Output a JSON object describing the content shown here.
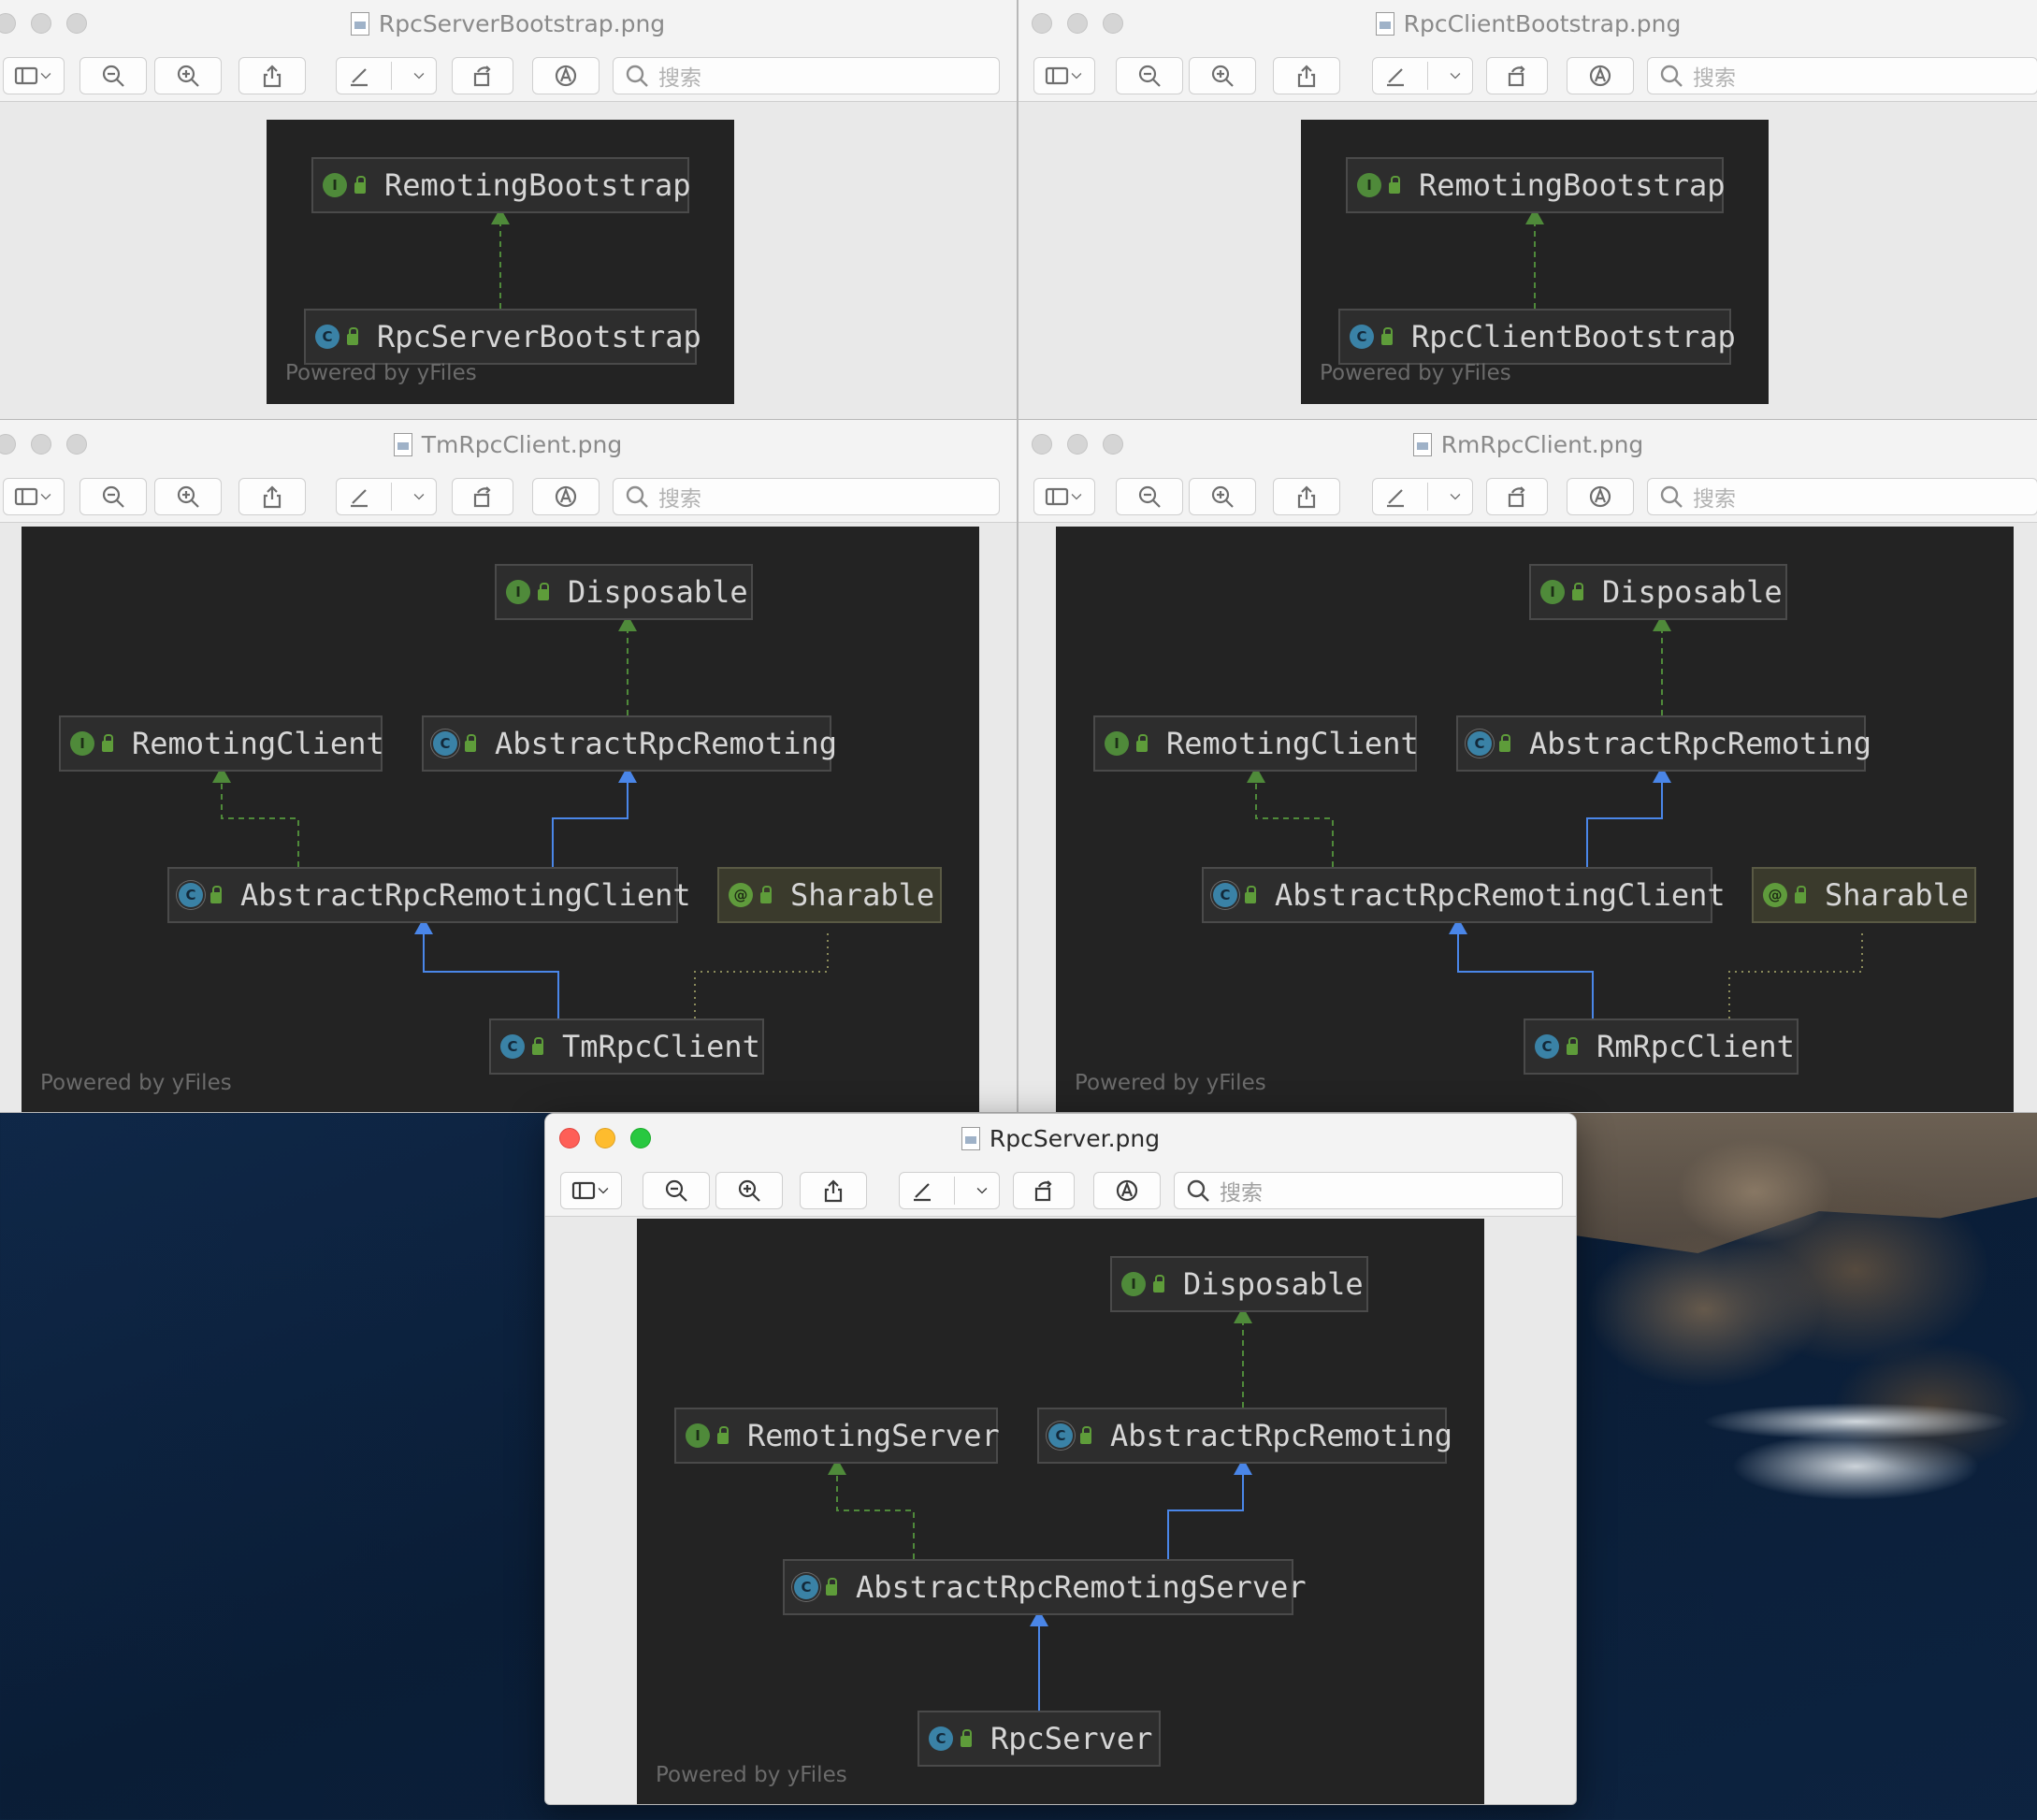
{
  "search_placeholder": "搜索",
  "powered_by": "Powered by yFiles",
  "windows": {
    "server_bootstrap": {
      "title": "RpcServerBootstrap.png",
      "nodes": {
        "remoting_bootstrap": {
          "label": "RemotingBootstrap",
          "kind": "interface"
        },
        "rpc_server_bootstrap": {
          "label": "RpcServerBootstrap",
          "kind": "class"
        }
      }
    },
    "client_bootstrap": {
      "title": "RpcClientBootstrap.png",
      "nodes": {
        "remoting_bootstrap": {
          "label": "RemotingBootstrap",
          "kind": "interface"
        },
        "rpc_client_bootstrap": {
          "label": "RpcClientBootstrap",
          "kind": "class"
        }
      }
    },
    "tm_client": {
      "title": "TmRpcClient.png",
      "nodes": {
        "disposable": {
          "label": "Disposable",
          "kind": "interface"
        },
        "remoting_client": {
          "label": "RemotingClient",
          "kind": "interface"
        },
        "abstract_rpc_remoting": {
          "label": "AbstractRpcRemoting",
          "kind": "abstract-class"
        },
        "abstract_rpc_remoting_client": {
          "label": "AbstractRpcRemotingClient",
          "kind": "abstract-class"
        },
        "sharable": {
          "label": "Sharable",
          "kind": "annotation"
        },
        "tm_rpc_client": {
          "label": "TmRpcClient",
          "kind": "class"
        }
      }
    },
    "rm_client": {
      "title": "RmRpcClient.png",
      "nodes": {
        "disposable": {
          "label": "Disposable",
          "kind": "interface"
        },
        "remoting_client": {
          "label": "RemotingClient",
          "kind": "interface"
        },
        "abstract_rpc_remoting": {
          "label": "AbstractRpcRemoting",
          "kind": "abstract-class"
        },
        "abstract_rpc_remoting_client": {
          "label": "AbstractRpcRemotingClient",
          "kind": "abstract-class"
        },
        "sharable": {
          "label": "Sharable",
          "kind": "annotation"
        },
        "rm_rpc_client": {
          "label": "RmRpcClient",
          "kind": "class"
        }
      }
    },
    "rpc_server": {
      "title": "RpcServer.png",
      "nodes": {
        "disposable": {
          "label": "Disposable",
          "kind": "interface"
        },
        "remoting_server": {
          "label": "RemotingServer",
          "kind": "interface"
        },
        "abstract_rpc_remoting": {
          "label": "AbstractRpcRemoting",
          "kind": "abstract-class"
        },
        "abstract_rpc_remoting_server": {
          "label": "AbstractRpcRemotingServer",
          "kind": "abstract-class"
        },
        "rpc_server": {
          "label": "RpcServer",
          "kind": "class"
        }
      }
    }
  },
  "badges": {
    "interface": "I",
    "class": "C",
    "abstract-class": "C",
    "annotation": "@"
  },
  "colors": {
    "implements_edge": "#4f8a3a",
    "extends_edge": "#4a86e8",
    "annotation_edge": "#8a8a5a",
    "canvas_bg": "#232323",
    "close_button": "#fe5f57",
    "minimize_button": "#febc2e",
    "zoom_button": "#28c840"
  },
  "icons": {
    "sidebar": "sidebar-icon",
    "zoom_out": "zoom-out-icon",
    "zoom_in": "zoom-in-icon",
    "share": "share-icon",
    "markup": "pen-icon",
    "rotate": "rotate-icon",
    "annotate": "markup-circle-icon",
    "search": "search-icon"
  }
}
